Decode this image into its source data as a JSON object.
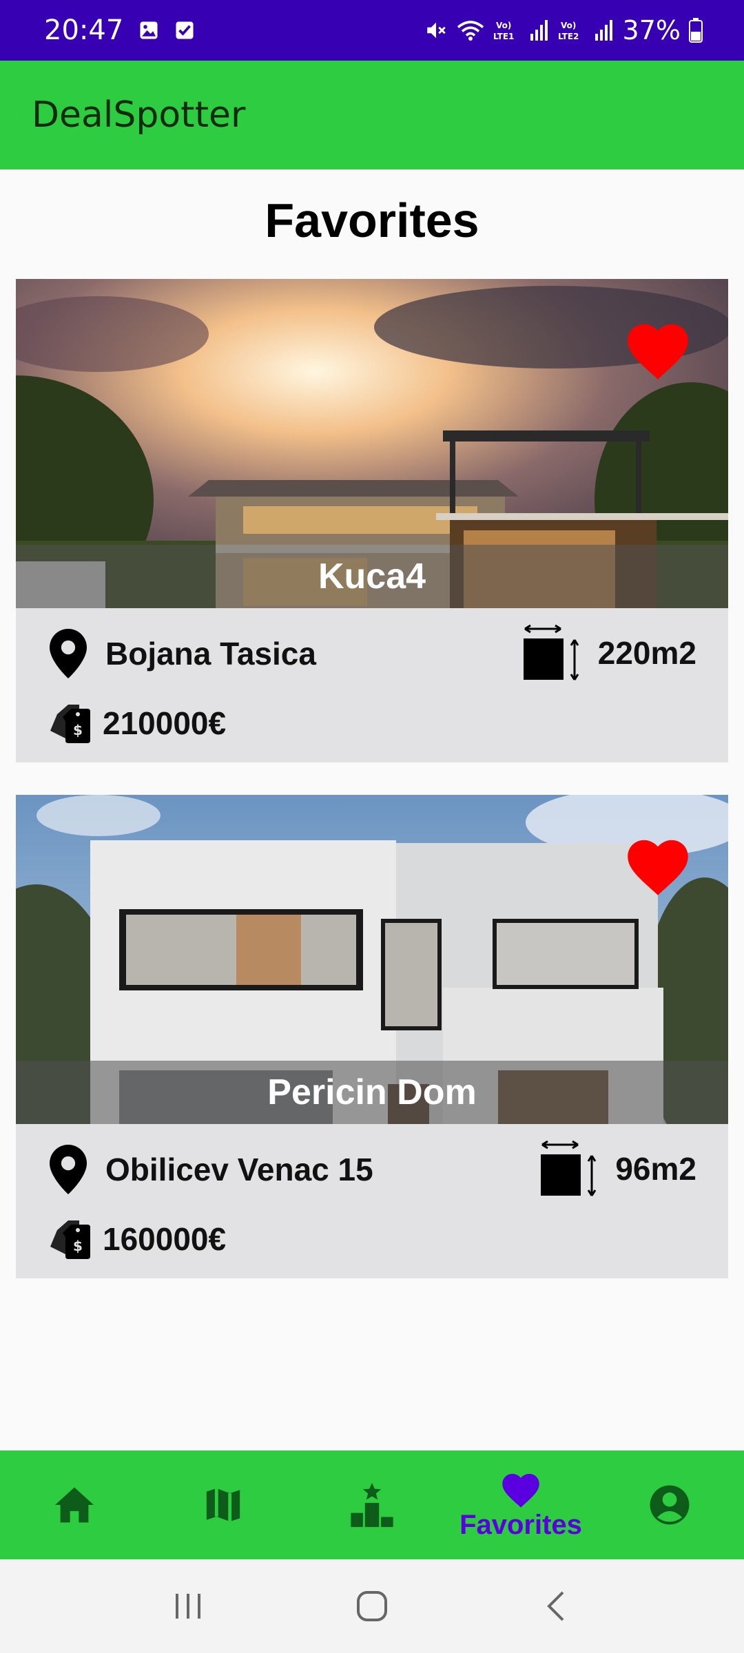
{
  "status_bar": {
    "time": "20:47",
    "battery": "37%",
    "icons": [
      "image-icon",
      "checkbox-icon",
      "mute-icon",
      "wifi-icon",
      "volte-lte1-icon",
      "signal-icon",
      "volte-lte2-icon",
      "signal-icon",
      "battery-icon"
    ]
  },
  "app_bar": {
    "title": "DealSpotter"
  },
  "page": {
    "title": "Favorites"
  },
  "listings": [
    {
      "name": "Kuca4",
      "location": "Bojana Tasica",
      "area": "220m2",
      "price": "210000€",
      "favorited": true
    },
    {
      "name": "Pericin Dom",
      "location": "Obilicev Venac 15",
      "area": "96m2",
      "price": "160000€",
      "favorited": true
    }
  ],
  "bottom_nav": {
    "items": [
      {
        "icon": "home-icon",
        "label": ""
      },
      {
        "icon": "map-icon",
        "label": ""
      },
      {
        "icon": "leaderboard-icon",
        "label": ""
      },
      {
        "icon": "heart-icon",
        "label": "Favorites",
        "active": true
      },
      {
        "icon": "account-icon",
        "label": ""
      }
    ]
  },
  "colors": {
    "status_bar": "#3700b3",
    "app_bar": "#2ecc40",
    "heart": "#ff0000",
    "nav_active": "#5a00e0",
    "nav_icon": "#0d5c1a"
  }
}
